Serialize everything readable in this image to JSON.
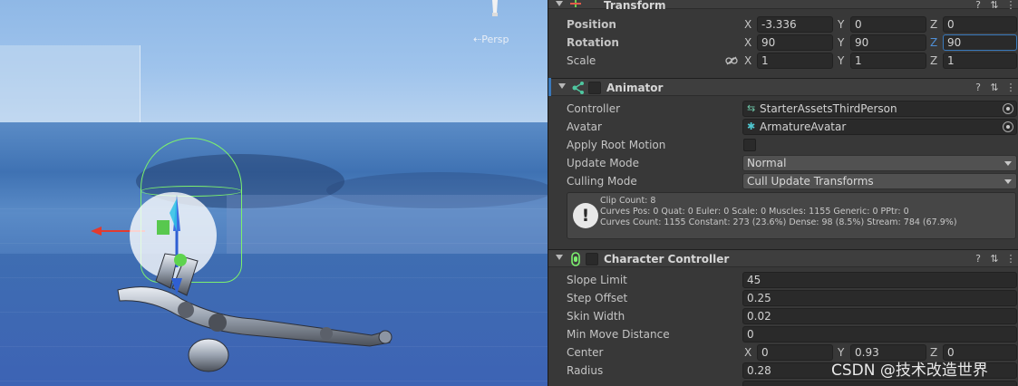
{
  "scene": {
    "view_mode": "Persp"
  },
  "transform": {
    "title": "Transform",
    "position": {
      "label": "Position",
      "x": "-3.336",
      "y": "0",
      "z": "0"
    },
    "rotation": {
      "label": "Rotation",
      "x": "90",
      "y": "90",
      "z": "90"
    },
    "scale": {
      "label": "Scale",
      "x": "1",
      "y": "1",
      "z": "1"
    },
    "axes": {
      "x": "X",
      "y": "Y",
      "z": "Z"
    }
  },
  "animator": {
    "title": "Animator",
    "controller": {
      "label": "Controller",
      "value": "StarterAssetsThirdPerson"
    },
    "avatar": {
      "label": "Avatar",
      "value": "ArmatureAvatar"
    },
    "apply_root_motion": {
      "label": "Apply Root Motion",
      "checked": false
    },
    "update_mode": {
      "label": "Update Mode",
      "value": "Normal"
    },
    "culling_mode": {
      "label": "Culling Mode",
      "value": "Cull Update Transforms"
    },
    "info": {
      "line1": "Clip Count: 8",
      "line2": "Curves Pos: 0 Quat: 0 Euler: 0 Scale: 0 Muscles: 1155 Generic: 0 PPtr: 0",
      "line3": "Curves Count: 1155 Constant: 273 (23.6%) Dense: 98 (8.5%) Stream: 784 (67.9%)"
    }
  },
  "character_controller": {
    "title": "Character Controller",
    "slope_limit": {
      "label": "Slope Limit",
      "value": "45"
    },
    "step_offset": {
      "label": "Step Offset",
      "value": "0.25"
    },
    "skin_width": {
      "label": "Skin Width",
      "value": "0.02"
    },
    "min_move_distance": {
      "label": "Min Move Distance",
      "value": "0"
    },
    "center": {
      "label": "Center",
      "x": "0",
      "y": "0.93",
      "z": "0"
    },
    "radius": {
      "label": "Radius",
      "value": "0.28"
    }
  },
  "header_icons": {
    "help": "?",
    "settings": "⇅",
    "menu": "⋮"
  },
  "watermark": "CSDN @技术改造世界",
  "colors": {
    "accent": "#3a79bb",
    "capsule": "#7cf06e",
    "inspector_bg": "#383838",
    "field_bg": "#2a2a2a"
  }
}
